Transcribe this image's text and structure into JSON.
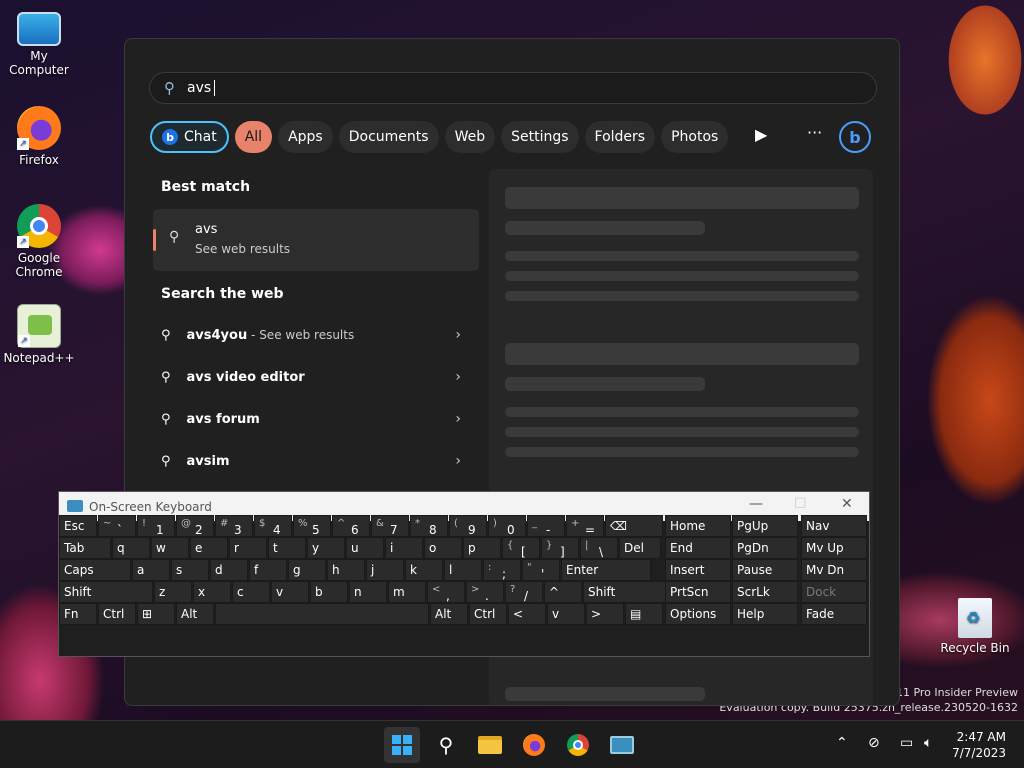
{
  "desktop": {
    "icons": [
      {
        "label": "My Computer",
        "icon": "monitor-icon"
      },
      {
        "label": "Firefox",
        "icon": "firefox-icon"
      },
      {
        "label": "Google Chrome",
        "icon": "chrome-icon"
      },
      {
        "label": "Notepad++",
        "icon": "notepadpp-icon"
      },
      {
        "label": "Recycle Bin",
        "icon": "recycle-bin-icon"
      }
    ],
    "watermark_line1": "s 11 Pro Insider Preview",
    "watermark_line2": "Evaluation copy. Build 25375.zn_release.230520-1632"
  },
  "search": {
    "query": "avs",
    "icon": "search-icon"
  },
  "filters": [
    "Chat",
    "All",
    "Apps",
    "Documents",
    "Web",
    "Settings",
    "Folders",
    "Photos"
  ],
  "best_match": {
    "heading": "Best match",
    "title": "avs",
    "subtitle": "See web results"
  },
  "web": {
    "heading": "Search the web",
    "items": [
      {
        "text": "avs4you",
        "suffix": " - See web results"
      },
      {
        "text": "avs video editor",
        "suffix": ""
      },
      {
        "text": "avs forum",
        "suffix": ""
      },
      {
        "text": "avsim",
        "suffix": ""
      }
    ]
  },
  "osk": {
    "title": "On-Screen Keyboard",
    "rows": [
      [
        "Esc",
        "~ `",
        "! 1",
        "@ 2",
        "# 3",
        "$ 4",
        "% 5",
        "^ 6",
        "& 7",
        "* 8",
        "( 9",
        ") 0",
        "_ -",
        "+ =",
        "⌫"
      ],
      [
        "Tab",
        "q",
        "w",
        "e",
        "r",
        "t",
        "y",
        "u",
        "i",
        "o",
        "p",
        "{ [",
        "} ]",
        "| \\",
        "Del"
      ],
      [
        "Caps",
        "a",
        "s",
        "d",
        "f",
        "g",
        "h",
        "j",
        "k",
        "l",
        ": ;",
        "\" '",
        "Enter"
      ],
      [
        "Shift",
        "z",
        "x",
        "c",
        "v",
        "b",
        "n",
        "m",
        "< ,",
        "> .",
        "? /",
        "^",
        "Shift"
      ],
      [
        "Fn",
        "Ctrl",
        "⊞",
        "Alt",
        "",
        "Alt",
        "Ctrl",
        "<",
        "v",
        ">",
        "▤"
      ]
    ],
    "nav": [
      [
        "Home",
        "PgUp",
        "Nav"
      ],
      [
        "End",
        "PgDn",
        "Mv Up"
      ],
      [
        "Insert",
        "Pause",
        "Mv Dn"
      ],
      [
        "PrtScn",
        "ScrLk",
        "Dock"
      ],
      [
        "Options",
        "Help",
        "Fade"
      ]
    ]
  },
  "clock": {
    "time": "2:47 AM",
    "date": "7/7/2023"
  }
}
